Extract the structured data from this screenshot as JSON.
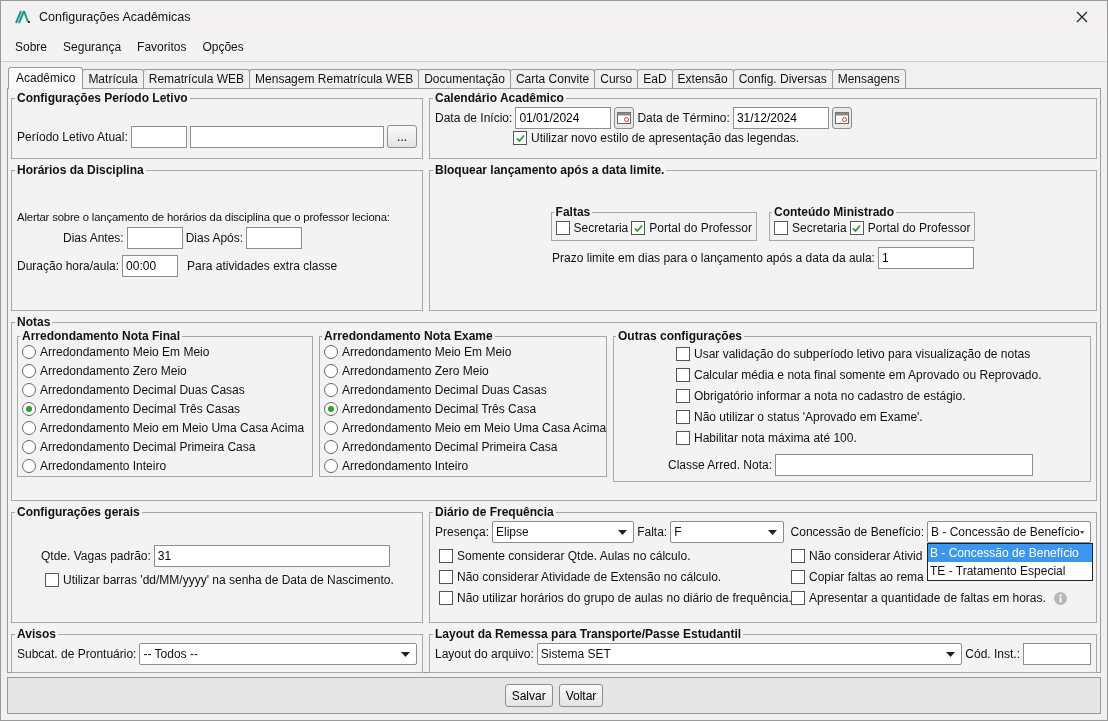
{
  "window": {
    "title": "Configurações Acadêmicas"
  },
  "menu": [
    {
      "label": "Sobre"
    },
    {
      "label": "Segurança"
    },
    {
      "label": "Favoritos"
    },
    {
      "label": "Opções"
    }
  ],
  "tabs": [
    {
      "label": "Acadêmico",
      "selected": true
    },
    {
      "label": "Matrícula",
      "selected": false
    },
    {
      "label": "Rematrícula WEB",
      "selected": false
    },
    {
      "label": "Mensagem Rematrícula WEB",
      "selected": false
    },
    {
      "label": "Documentação",
      "selected": false
    },
    {
      "label": "Carta Convite",
      "selected": false
    },
    {
      "label": "Curso",
      "selected": false
    },
    {
      "label": "EaD",
      "selected": false
    },
    {
      "label": "Extensão",
      "selected": false
    },
    {
      "label": "Config. Diversas",
      "selected": false
    },
    {
      "label": "Mensagens",
      "selected": false
    }
  ],
  "periodo_letivo": {
    "title": "Configurações Período Letivo",
    "label": "Período Letivo Atual:",
    "browse_button": "..."
  },
  "calendario": {
    "title": "Calendário Acadêmico",
    "start_label": "Data de Início:",
    "start": "01/01/2024",
    "end_label": "Data de Término:",
    "end": "31/12/2024",
    "legend_option": {
      "label": "Utilizar novo estilo de apresentação das legendas.",
      "checked": true
    }
  },
  "horarios": {
    "title": "Horários da Disciplina",
    "alert": "Alertar sobre o lançamento de horários da disciplina que o professor leciona:",
    "days_before_label": "Dias Antes:",
    "days_after_label": "Dias Após:",
    "duration_label": "Duração hora/aula:",
    "duration": "00:00",
    "extra_note": "Para atividades extra classe"
  },
  "bloquear": {
    "title": "Bloquear lançamento após a data limite.",
    "groups": [
      {
        "title": "Faltas",
        "options": [
          {
            "label": "Secretaria",
            "checked": false
          },
          {
            "label": "Portal do Professor",
            "checked": true
          }
        ]
      },
      {
        "title": "Conteúdo Ministrado",
        "options": [
          {
            "label": "Secretaria",
            "checked": false
          },
          {
            "label": "Portal do Professor",
            "checked": true
          }
        ]
      }
    ],
    "deadline_label": "Prazo limite em dias para o lançamento após a data da aula:",
    "deadline": "1"
  },
  "notas": {
    "title": "Notas",
    "rounding_groups": [
      {
        "title": "Arredondamento Nota Final",
        "options": [
          {
            "label": "Arredondamento Meio Em Meio",
            "selected": false
          },
          {
            "label": "Arredondamento Zero Meio",
            "selected": false
          },
          {
            "label": "Arredondamento Decimal Duas Casas",
            "selected": false
          },
          {
            "label": "Arredondamento Decimal Três Casas",
            "selected": true
          },
          {
            "label": "Arredondamento Meio em Meio Uma Casa Acima",
            "selected": false
          },
          {
            "label": "Arredondamento Decimal Primeira Casa",
            "selected": false
          },
          {
            "label": "Arredondamento Inteiro",
            "selected": false
          }
        ]
      },
      {
        "title": "Arredondamento Nota Exame",
        "options": [
          {
            "label": "Arredondamento Meio Em Meio",
            "selected": false
          },
          {
            "label": "Arredondamento Zero Meio",
            "selected": false
          },
          {
            "label": "Arredondamento Decimal Duas Casas",
            "selected": false
          },
          {
            "label": "Arredondamento Decimal Três Casa",
            "selected": true
          },
          {
            "label": "Arredondamento Meio em Meio Uma Casa Acima",
            "selected": false
          },
          {
            "label": "Arredondamento Decimal Primeira Casa",
            "selected": false
          },
          {
            "label": "Arredondamento Inteiro",
            "selected": false
          }
        ]
      }
    ],
    "other": {
      "title": "Outras configurações",
      "options": [
        {
          "label": "Usar validação do subperíodo letivo para visualização de notas",
          "checked": false
        },
        {
          "label": "Calcular média e nota final somente em Aprovado ou Reprovado.",
          "checked": false
        },
        {
          "label": "Obrigatório informar a nota no cadastro de estágio.",
          "checked": false
        },
        {
          "label": "Não utilizar o status 'Aprovado em Exame'.",
          "checked": false
        },
        {
          "label": "Habilitar nota máxima até 100.",
          "checked": false
        }
      ],
      "class_label": "Classe Arred. Nota:"
    }
  },
  "gerais": {
    "title": "Configurações gerais",
    "vagas_label": "Qtde. Vagas padrão:",
    "vagas": "31",
    "barras_option": {
      "label": "Utilizar barras 'dd/MM/yyyy' na senha de Data de Nascimento.",
      "checked": false
    }
  },
  "diario": {
    "title": "Diário de Frequência",
    "presenca_label": "Presença:",
    "presenca": "Elipse",
    "falta_label": "Falta:",
    "falta": "F",
    "beneficio_label": "Concessão de Benefício:",
    "beneficio": "B - Concessão de Benefício",
    "beneficio_options": [
      {
        "label": "B - Concessão de Benefício",
        "selected": true
      },
      {
        "label": "TE - Tratamento Especial",
        "selected": false
      }
    ],
    "options": [
      {
        "label": "Somente considerar Qtde. Aulas no cálculo.",
        "checked": false
      },
      {
        "label": "Não considerar Ativid",
        "checked": false
      },
      {
        "label": "Não considerar Atividade de Extensão no cálculo.",
        "checked": false
      },
      {
        "label": "Copiar faltas ao rema",
        "checked": false
      },
      {
        "label": "Não utilizar horários do grupo de aulas no diário de frequência.",
        "checked": false
      },
      {
        "label": "Apresentar a quantidade de faltas em horas.",
        "checked": false
      }
    ],
    "last_option_info": true
  },
  "avisos": {
    "title": "Avisos",
    "label": "Subcat. de Prontuário:",
    "value": "-- Todos --"
  },
  "remessa": {
    "title": "Layout da Remessa para Transporte/Passe Estudantil",
    "layout_label": "Layout do arquivo:",
    "layout": "Sistema SET",
    "inst_label": "Cód. Inst.:"
  },
  "buttons": [
    {
      "label": "Salvar"
    },
    {
      "label": "Voltar"
    }
  ]
}
